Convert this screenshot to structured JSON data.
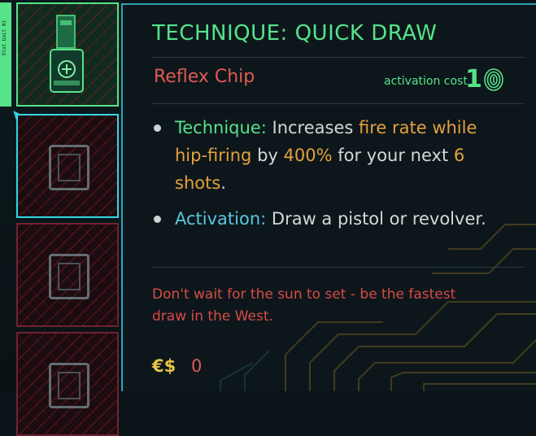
{
  "slots": [
    {
      "state": "equipped",
      "rail_text": "Slot Unit 01"
    },
    {
      "state": "selected"
    },
    {
      "state": "empty"
    },
    {
      "state": "empty"
    }
  ],
  "tooltip": {
    "title": "TECHNIQUE: QUICK DRAW",
    "category": "Reflex Chip",
    "activation_cost_label": "activation cost",
    "activation_cost_value": "1",
    "bullets": [
      {
        "keyword": "Technique:",
        "keyword_color": "#56e38a",
        "parts": [
          {
            "text": " Increases ",
            "style": "plain"
          },
          {
            "text": "fire rate while hip-firing",
            "style": "highlight"
          },
          {
            "text": " by ",
            "style": "plain"
          },
          {
            "text": "400%",
            "style": "highlight"
          },
          {
            "text": " for your next ",
            "style": "plain"
          },
          {
            "text": "6 shots",
            "style": "highlight"
          },
          {
            "text": ".",
            "style": "plain"
          }
        ]
      },
      {
        "keyword": "Activation:",
        "keyword_color": "#5bc6df",
        "parts": [
          {
            "text": " Draw a pistol or revolver.",
            "style": "plain"
          }
        ]
      }
    ],
    "flavor_text": "Don't wait for the sun to set - be the fastest draw in the West.",
    "price_symbol": "€$",
    "price_value": "0"
  },
  "colors": {
    "accent_green": "#56e38a",
    "accent_cyan": "#35d6e6",
    "red": "#e05a52",
    "orange": "#e5a03c",
    "gold": "#e5c542"
  },
  "icons": {
    "cost_icon": "fingerprint-icon",
    "chip_icon": "reflex-chip-icon",
    "slot_icon": "chip-socket-icon"
  }
}
